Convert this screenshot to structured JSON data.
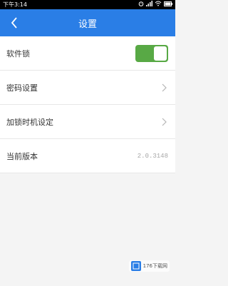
{
  "status_bar": {
    "time": "下午3:14",
    "icons": [
      "alarm-icon",
      "signal-icon",
      "wifi-icon",
      "battery-icon"
    ]
  },
  "header": {
    "title": "设置",
    "back_icon": "chevron-left-icon",
    "bg_color": "#2a7ee6"
  },
  "settings": {
    "app_lock": {
      "label": "软件锁",
      "enabled": true,
      "toggle_color": "#58a945"
    },
    "password": {
      "label": "密码设置"
    },
    "lock_time": {
      "label": "加锁时机设定"
    },
    "version": {
      "label": "当前版本",
      "value": "2.0.3148"
    }
  },
  "watermark": {
    "text": "176下载网"
  }
}
